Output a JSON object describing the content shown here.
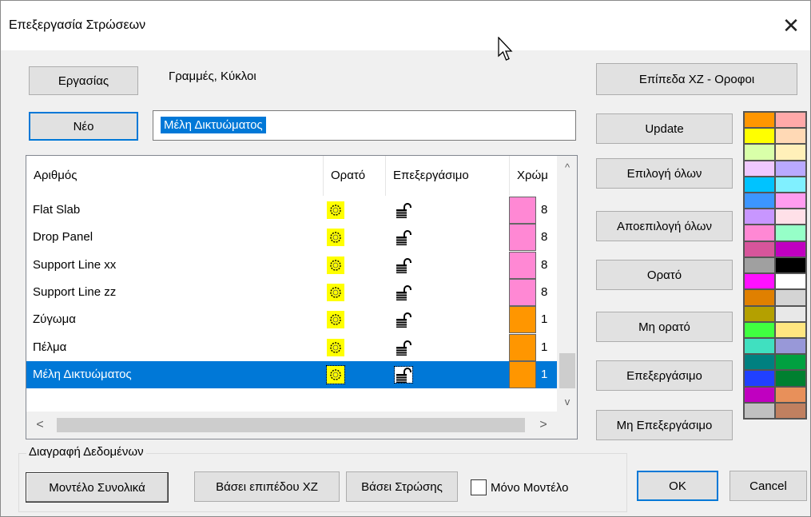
{
  "window": {
    "title": "Επεξεργασία Στρώσεων"
  },
  "top": {
    "work_button": "Εργασίας",
    "work_label": "Γραμμές, Κύκλοι",
    "new_button": "Νέο",
    "name_value": "Μέλη Δικτυώματος"
  },
  "list": {
    "headers": [
      "Αριθμός",
      "Ορατό",
      "Επεξεργάσιμο",
      "Χρώμ"
    ],
    "rows": [
      {
        "name": "Flat Slab",
        "color": "#ff88d4",
        "num": "8"
      },
      {
        "name": "Drop Panel",
        "color": "#ff88d4",
        "num": "8"
      },
      {
        "name": "Support Line xx",
        "color": "#ff88d4",
        "num": "8"
      },
      {
        "name": "Support Line zz",
        "color": "#ff88d4",
        "num": "8"
      },
      {
        "name": "Ζύγωμα",
        "color": "#ff9600",
        "num": "1"
      },
      {
        "name": "Πέλμα",
        "color": "#ff9600",
        "num": "1"
      },
      {
        "name": "Μέλη Δικτυώματος",
        "color": "#ff9600",
        "num": "1"
      }
    ],
    "selected_row": 6,
    "scroll": {
      "up": "^",
      "down": "v",
      "left": "<",
      "right": ">"
    }
  },
  "right_buttons": {
    "planes": "Επίπεδα XZ - Οροφοι",
    "update": "Update",
    "select_all": "Επιλογή όλων",
    "deselect_all": "Αποεπιλογή όλων",
    "visible": "Ορατό",
    "not_visible": "Μη ορατό",
    "editable": "Επεξεργάσιμο",
    "not_editable": "Μη Επεξεργάσιμο"
  },
  "delete_group": {
    "title": "Διαγραφή Δεδομένων",
    "model_total": "Μοντέλο Συνολικά",
    "by_plane": "Βάσει επιπέδου XZ",
    "by_layer": "Βάσει Στρώσης",
    "model_only": "Μόνο Μοντέλο",
    "model_only_checked": false
  },
  "footer": {
    "ok": "OK",
    "cancel": "Cancel"
  },
  "palette": [
    [
      "#ff9600",
      "#ffa9a9"
    ],
    [
      "#ffff00",
      "#ffd9b5"
    ],
    [
      "#d9ffa9",
      "#fff0b9"
    ],
    [
      "#f0c8ff",
      "#b9a9ff"
    ],
    [
      "#00c3ff",
      "#80f0ff"
    ],
    [
      "#3c96ff",
      "#ff9cf0"
    ],
    [
      "#c896ff",
      "#ffe0e8"
    ],
    [
      "#ff88d4",
      "#96ffc8"
    ],
    [
      "#d7559b",
      "#c000c0"
    ],
    [
      "#a0a0a0",
      "#000000"
    ],
    [
      "#ff10ff",
      "#ffffff"
    ],
    [
      "#e08000",
      "#d4d4d4"
    ],
    [
      "#b4a000",
      "#e8e8e8"
    ],
    [
      "#40ff40",
      "#ffe680"
    ],
    [
      "#40e0c0",
      "#9898d8"
    ],
    [
      "#008080",
      "#00a040"
    ],
    [
      "#2040ff",
      "#008030"
    ],
    [
      "#c000c0",
      "#e8905a"
    ],
    [
      "#c0c0c0",
      "#c08060"
    ]
  ]
}
